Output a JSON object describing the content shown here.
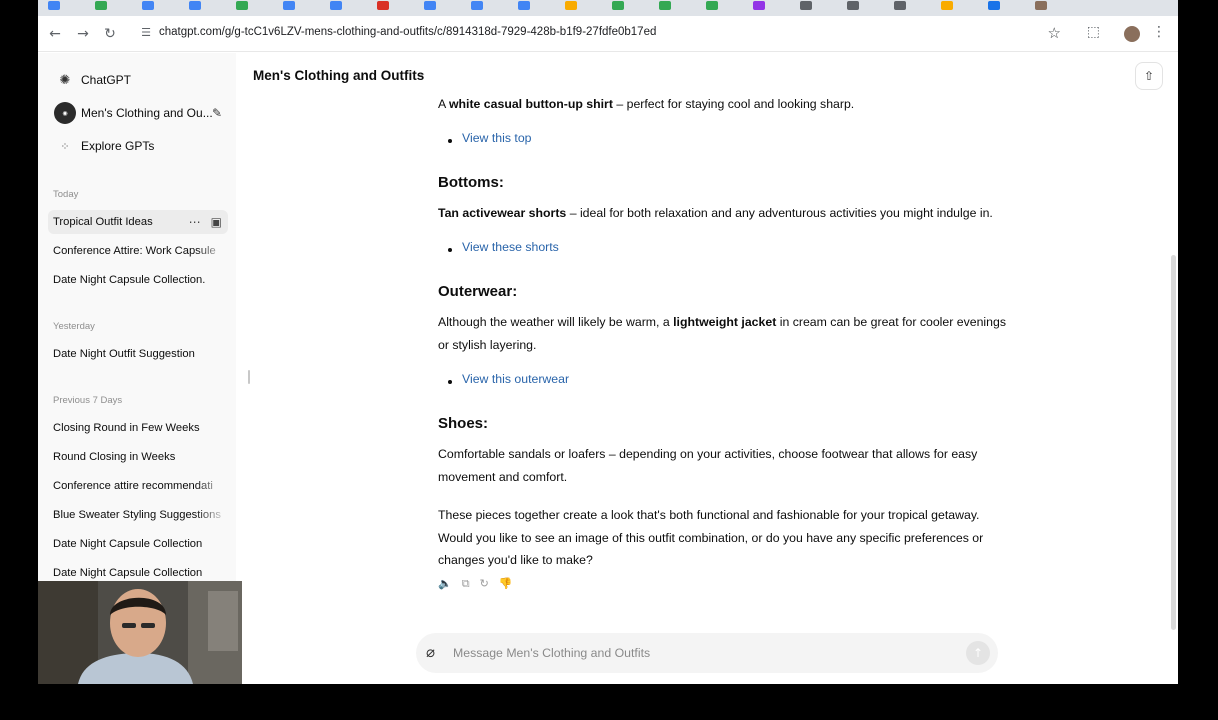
{
  "browser": {
    "url": "chatgpt.com/g/g-tcC1v6LZV-mens-clothing-and-outfits/c/8914318d-7929-428b-b1f9-27fdfe0b17ed",
    "tab_icon_colors": [
      "#4285f4",
      "#34a853",
      "#4285f4",
      "#4285f4",
      "#34a853",
      "#4285f4",
      "#4285f4",
      "#d93025",
      "#4285f4",
      "#4285f4",
      "#4285f4",
      "#f9ab00",
      "#34a853",
      "#34a853",
      "#34a853",
      "#9334e6",
      "#5f6368",
      "#5f6368",
      "#5f6368",
      "#f9ab00",
      "#1a73e8",
      "#8a6f5c"
    ]
  },
  "sidebar": {
    "app_name": "ChatGPT",
    "gpt_name": "Men's Clothing and Ou...",
    "explore": "Explore GPTs",
    "sections": [
      {
        "heading": "Today",
        "items": [
          "Tropical Outfit Ideas",
          "Conference Attire: Work Capsule",
          "Date Night Capsule Collection."
        ]
      },
      {
        "heading": "Yesterday",
        "items": [
          "Date Night Outfit Suggestion"
        ]
      },
      {
        "heading": "Previous 7 Days",
        "items": [
          "Closing Round in Few Weeks",
          "Round Closing in Weeks",
          "Conference attire recommendati",
          "Blue Sweater Styling Suggestions",
          "Date Night Capsule Collection",
          "Date Night Capsule Collection"
        ]
      }
    ]
  },
  "header": {
    "title": "Men's Clothing and Outfits"
  },
  "message": {
    "top_intro": "A",
    "top_bold": "white casual button-up shirt",
    "top_rest": "– perfect for staying cool and looking sharp.",
    "top_link": "View this top",
    "bottoms_heading": "Bottoms:",
    "bottoms_bold": "Tan activewear shorts",
    "bottoms_rest": "– ideal for both relaxation and any adventurous activities you might indulge in.",
    "bottoms_link": "View these shorts",
    "outerwear_heading": "Outerwear:",
    "outerwear_intro": "Although the weather will likely be warm, a",
    "outerwear_bold": "lightweight jacket",
    "outerwear_rest": "in cream can be great for cooler evenings or stylish layering.",
    "outerwear_link": "View this outerwear",
    "shoes_heading": "Shoes:",
    "shoes_text": "Comfortable sandals or loafers – depending on your activities, choose footwear that allows for easy movement and comfort.",
    "closing_text": "These pieces together create a look that's both functional and fashionable for your tropical getaway. Would you like to see an image of this outfit combination, or do you have any specific preferences or changes you'd like to make?"
  },
  "composer": {
    "placeholder": "Message Men's Clothing and Outfits"
  }
}
